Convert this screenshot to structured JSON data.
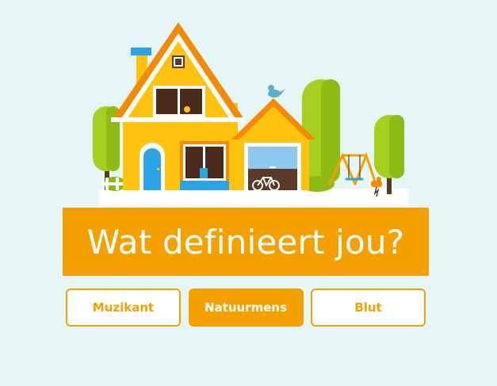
{
  "question": {
    "title": "Wat definieert jou?"
  },
  "choices": [
    {
      "label": "Muzikant",
      "selected": false
    },
    {
      "label": "Natuurmens",
      "selected": true
    },
    {
      "label": "Blut",
      "selected": false
    }
  ],
  "colors": {
    "accent": "#f4a100",
    "background": "#e6f6f6",
    "house": "#ffc20e",
    "roof": "#f48a00",
    "tree": "#a6cf1f",
    "door": "#2aa4e4"
  },
  "illustration": {
    "icons": [
      "house-icon",
      "garage-icon",
      "tree-icon",
      "bird-icon",
      "swing-set-icon",
      "bicycle-icon",
      "spring-rider-icon"
    ]
  }
}
